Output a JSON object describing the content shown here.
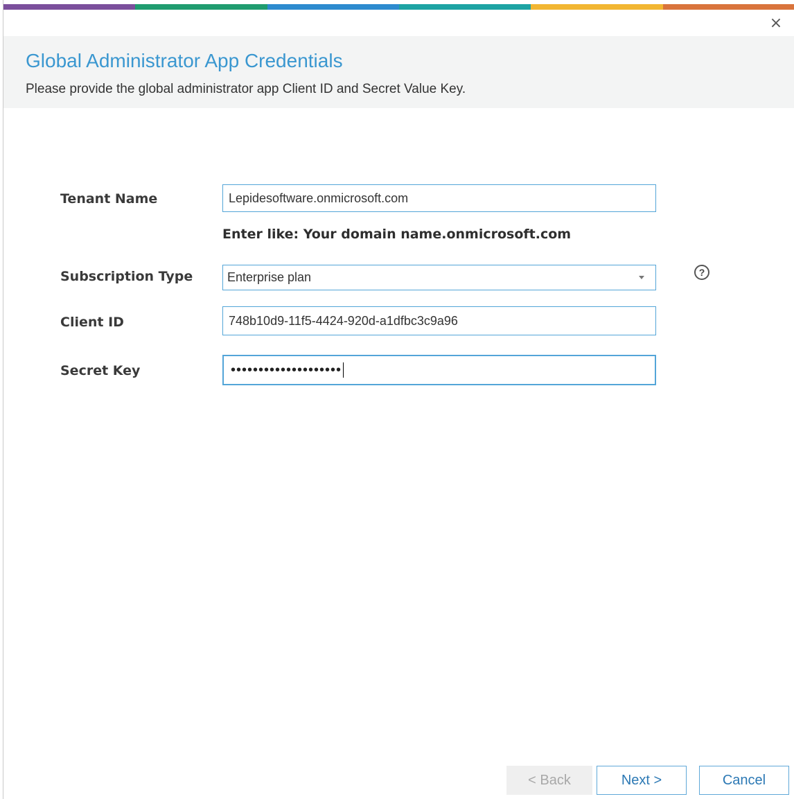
{
  "window": {
    "close_glyph": "×",
    "accent_colors": [
      "#7b4f9c",
      "#1f9c6f",
      "#2d8bcf",
      "#1da3a3",
      "#f2b632",
      "#d9743c"
    ]
  },
  "header": {
    "title": "Global Administrator App Credentials",
    "subtitle": "Please provide the global administrator app Client ID and Secret Value Key."
  },
  "form": {
    "tenant_name": {
      "label": "Tenant Name",
      "value": "Lepidesoftware.onmicrosoft.com",
      "hint": "Enter like: Your domain name.onmicrosoft.com"
    },
    "subscription_type": {
      "label": "Subscription Type",
      "selected": "Enterprise plan",
      "help_glyph": "?"
    },
    "client_id": {
      "label": "Client ID",
      "value": "748b10d9-11f5-4424-920d-a1dfbc3c9a96"
    },
    "secret_key": {
      "label": "Secret Key",
      "masked_value": "••••••••••••••••••••"
    }
  },
  "footer": {
    "back_label": "< Back",
    "next_label": "Next >",
    "cancel_label": "Cancel"
  }
}
